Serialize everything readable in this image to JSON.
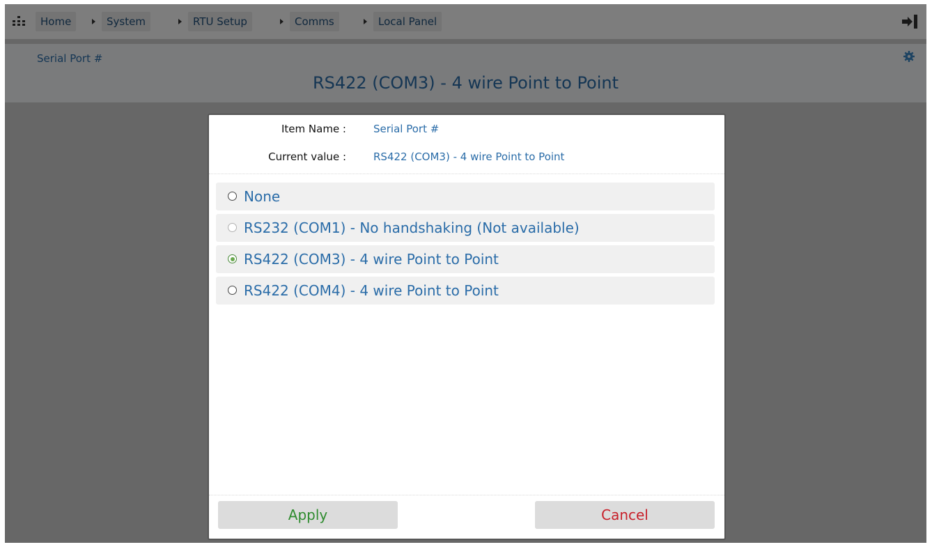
{
  "breadcrumb": {
    "items": [
      {
        "label": "Home"
      },
      {
        "label": "System"
      },
      {
        "label": "RTU Setup"
      },
      {
        "label": "Comms"
      },
      {
        "label": "Local Panel"
      }
    ]
  },
  "header": {
    "item_label": "Serial Port #",
    "item_value": "RS422 (COM3) - 4 wire Point to Point"
  },
  "dialog": {
    "item_name_label": "Item Name :",
    "item_name_value": "Serial Port #",
    "current_value_label": "Current value :",
    "current_value": "RS422 (COM3) - 4 wire Point to Point",
    "options": [
      {
        "label": "None",
        "state": "unchecked"
      },
      {
        "label": "RS232 (COM1) - No handshaking (Not available)",
        "state": "disabled"
      },
      {
        "label": "RS422 (COM3) - 4 wire Point to Point",
        "state": "checked"
      },
      {
        "label": "RS422 (COM4) - 4 wire Point to Point",
        "state": "unchecked"
      }
    ],
    "apply_label": "Apply",
    "cancel_label": "Cancel"
  },
  "colors": {
    "link_blue": "#2a6ca8",
    "apply_green": "#2e8b2e",
    "cancel_red": "#c8202a",
    "overlay": "rgba(0,0,0,0.5)"
  },
  "icons": {
    "sitemap": "sitemap-icon",
    "logout": "logout-icon",
    "settings": "gear-icon"
  }
}
